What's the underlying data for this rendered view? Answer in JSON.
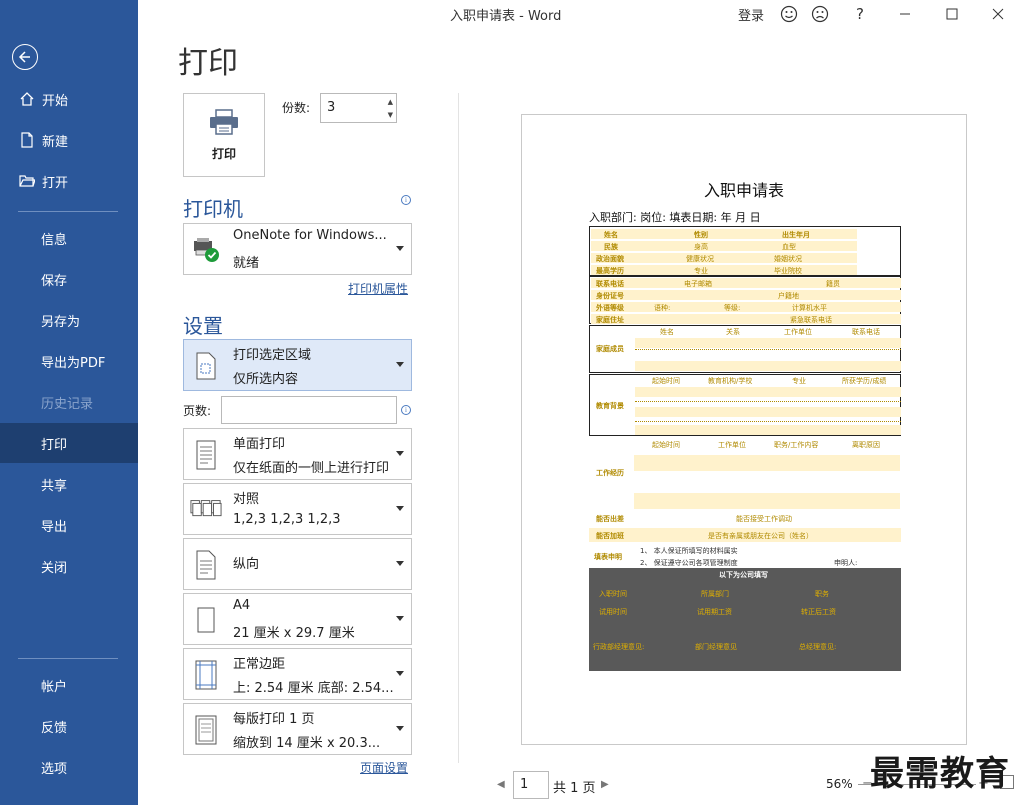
{
  "window": {
    "title": "入职申请表  -  Word",
    "login": "登录",
    "help": "?"
  },
  "sidebar": {
    "top_items": [
      {
        "label": "开始",
        "icon": "home-icon"
      },
      {
        "label": "新建",
        "icon": "new-document-icon"
      },
      {
        "label": "打开",
        "icon": "open-folder-icon"
      }
    ],
    "items": [
      {
        "label": "信息"
      },
      {
        "label": "保存"
      },
      {
        "label": "另存为"
      },
      {
        "label": "导出为PDF"
      },
      {
        "label": "历史记录",
        "disabled": true
      },
      {
        "label": "打印",
        "active": true
      },
      {
        "label": "共享"
      },
      {
        "label": "导出"
      },
      {
        "label": "关闭"
      }
    ],
    "bottom_items": [
      {
        "label": "帐户"
      },
      {
        "label": "反馈"
      },
      {
        "label": "选项"
      }
    ]
  },
  "print": {
    "heading": "打印",
    "button": "打印",
    "copies_label": "份数:",
    "copies_value": "3",
    "printer_heading": "打印机",
    "printer_name": "OneNote for Windows...",
    "printer_status": "就绪",
    "printer_props": "打印机属性",
    "settings_heading": "设置",
    "range_l1": "打印选定区域",
    "range_l2": "仅所选内容",
    "pages_label": "页数:",
    "pages_value": "",
    "sides_l1": "单面打印",
    "sides_l2": "仅在纸面的一侧上进行打印",
    "collate_l1": "对照",
    "collate_l2": "1,2,3     1,2,3     1,2,3",
    "orient_l1": "纵向",
    "paper_l1": "A4",
    "paper_l2": "21 厘米 x 29.7 厘米",
    "margin_l1": "正常边距",
    "margin_l2": "上: 2.54 厘米 底部: 2.54...",
    "persheet_l1": "每版打印 1 页",
    "persheet_l2": "缩放到 14 厘米 x 20.3...",
    "page_setup": "页面设置"
  },
  "preview": {
    "doc_title": "入职申请表",
    "doc_subtitle": "入职部门:      岗位:      填表日期:      年      月      日",
    "block1": [
      [
        "姓名",
        "性别",
        "出生年月"
      ],
      [
        "民族",
        "身高",
        "血型"
      ],
      [
        "政治面貌",
        "健康状况",
        "婚姻状况"
      ],
      [
        "最高学历",
        "专业",
        "毕业院校"
      ]
    ],
    "block2": [
      [
        "联系电话",
        "电子邮箱",
        "籍贯"
      ],
      [
        "身份证号",
        "",
        "户籍地"
      ],
      [
        "外语等级",
        "语种:",
        "等级:",
        "计算机水平"
      ],
      [
        "家庭住址",
        "",
        "紧急联系电话"
      ]
    ],
    "family_label": "家庭成员",
    "family_cols": [
      "姓名",
      "关系",
      "工作单位",
      "联系电话"
    ],
    "edu_label": "教育背景",
    "edu_cols": [
      "起始时间",
      "教育机构/学校",
      "专业",
      "所获学历/成绩"
    ],
    "work_label": "工作经历",
    "work_cols": [
      "起始时间",
      "工作单位",
      "职务/工作内容",
      "离职原因"
    ],
    "transfer_label": "能否出差",
    "transfer_text": "能否接受工作调动",
    "overtime_label": "能否加班",
    "overtime_text": "是否有亲属或朋友在公司（姓名）",
    "declare_label": "填表申明",
    "declare_1": "1、 本人保证所填写的材料属实",
    "declare_2": "2、 保证遵守公司各项管理制度",
    "applicant": "申明人:",
    "hr_title": "以下为公司填写",
    "hr_row1": [
      "入职时间",
      "所属部门",
      "职务"
    ],
    "hr_row2": [
      "试用时间",
      "试用期工资",
      "转正后工资"
    ],
    "hr_row3": [
      "行政部经理意见:",
      "部门经理意见",
      "总经理意见:"
    ]
  },
  "footer": {
    "page_num": "1",
    "page_total": "共 1 页",
    "zoom": "56%",
    "watermark": "最需教育"
  }
}
